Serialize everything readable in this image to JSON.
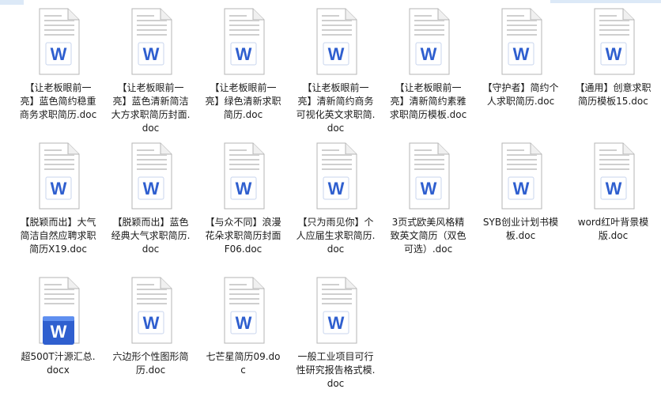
{
  "accent": "#2f5fcf",
  "icon_name": "word-doc-icon",
  "files": [
    {
      "name": "【让老板眼前一亮】蓝色简约稳重商务求职简历.doc"
    },
    {
      "name": "【让老板眼前一亮】蓝色清新简洁大方求职简历封面.doc"
    },
    {
      "name": "【让老板眼前一亮】绿色清新求职简历.doc"
    },
    {
      "name": "【让老板眼前一亮】清新简约商务可视化英文求职简.doc"
    },
    {
      "name": "【让老板眼前一亮】清新简约素雅求职简历模板.doc"
    },
    {
      "name": "【守护者】简约个人求职简历.doc"
    },
    {
      "name": "【通用】创意求职简历模板15.doc"
    },
    {
      "name": "【脱颖而出】大气简洁自然应聘求职简历X19.doc"
    },
    {
      "name": "【脱颖而出】蓝色经典大气求职简历.doc"
    },
    {
      "name": "【与众不同】浪漫花朵求职简历封面F06.doc"
    },
    {
      "name": "【只为雨见你】个人应届生求职简历.doc"
    },
    {
      "name": "3页式欧美风格精致英文简历（双色可选）.doc"
    },
    {
      "name": "SYB创业计划书模板.doc"
    },
    {
      "name": "word红叶背景模版.doc"
    },
    {
      "name": "超500T汁源汇总.docx",
      "docx": true
    },
    {
      "name": "六边形个性图形简历.doc"
    },
    {
      "name": "七芒星简历09.doc"
    },
    {
      "name": "一般工业项目可行性研究报告格式模.doc"
    }
  ]
}
